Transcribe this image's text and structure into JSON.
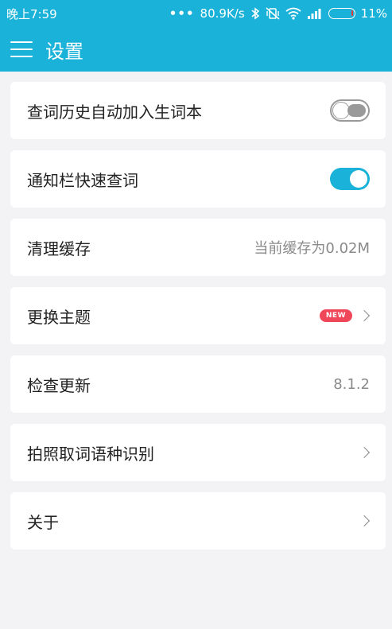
{
  "statusbar": {
    "time": "晚上7:59",
    "network_speed": "80.9K/s",
    "battery_percent": "11%",
    "icons": [
      "dots-icon",
      "bluetooth-icon",
      "vibrate-off-icon",
      "wifi-icon",
      "signal-icon",
      "battery-icon"
    ]
  },
  "appbar": {
    "title": "设置"
  },
  "settings": {
    "history_to_wordbook": {
      "label": "查词历史自动加入生词本",
      "enabled": false
    },
    "notification_quick_lookup": {
      "label": "通知栏快速查词",
      "enabled": true
    },
    "clear_cache": {
      "label": "清理缓存",
      "value": "当前缓存为0.02M"
    },
    "change_theme": {
      "label": "更换主题",
      "badge": "NEW"
    },
    "check_update": {
      "label": "检查更新",
      "value": "8.1.2"
    },
    "photo_language": {
      "label": "拍照取词语种识别"
    },
    "about": {
      "label": "关于"
    }
  },
  "colors": {
    "accent": "#1ab2d8",
    "badge": "#f0465a"
  }
}
